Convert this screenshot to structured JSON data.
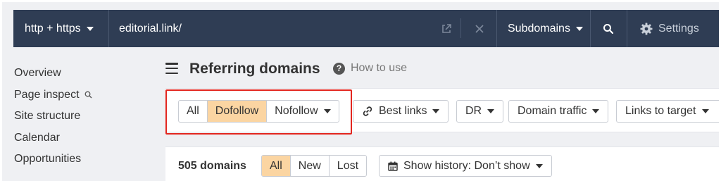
{
  "topbar": {
    "protocol_label": "http + https",
    "url_value": "editorial.link/",
    "mode_label": "Subdomains",
    "settings_label": "Settings"
  },
  "sidebar": {
    "items": [
      {
        "label": "Overview"
      },
      {
        "label": "Page inspect"
      },
      {
        "label": "Site structure"
      },
      {
        "label": "Calendar"
      },
      {
        "label": "Opportunities"
      }
    ]
  },
  "header": {
    "title": "Referring domains",
    "help_label": "How to use"
  },
  "filters": {
    "link_type": {
      "options": [
        "All",
        "Dofollow",
        "Nofollow"
      ],
      "selected": "Dofollow"
    },
    "best_links_label": "Best links",
    "dr_label": "DR",
    "domain_traffic_label": "Domain traffic",
    "links_to_target_label": "Links to target"
  },
  "results": {
    "count_label": "505 domains",
    "tabs": [
      "All",
      "New",
      "Lost"
    ],
    "selected_tab": "All",
    "history_label": "Show history: Don’t show"
  },
  "colors": {
    "topbar_bg": "#2f3d54",
    "active_option_bg": "#fbd5a2",
    "highlight_border": "#e3261f",
    "page_bg": "#eff0f3"
  },
  "icons": [
    "chevron-down-icon",
    "external-link-icon",
    "close-icon",
    "search-icon",
    "gear-icon",
    "search-small-icon",
    "hamburger-menu-icon",
    "question-circle-icon",
    "link-icon",
    "calendar-icon"
  ]
}
